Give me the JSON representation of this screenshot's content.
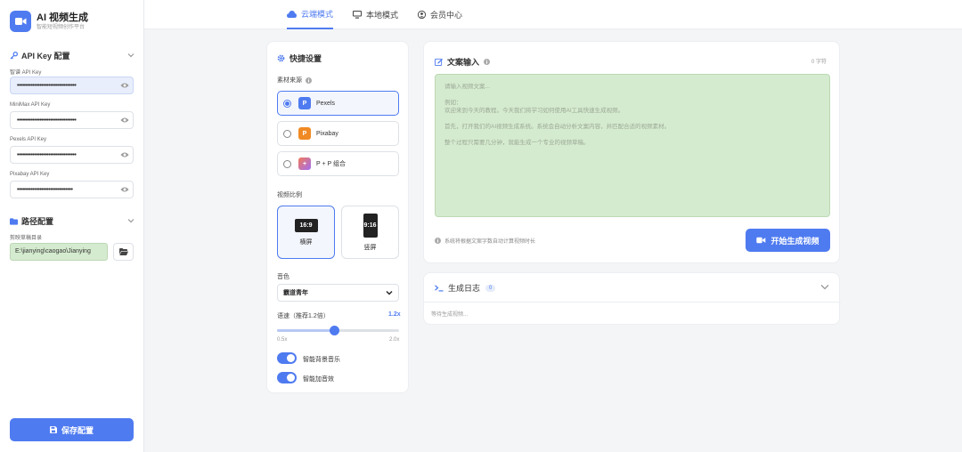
{
  "app": {
    "title": "AI 视频生成",
    "subtitle": "智能短视频创作平台"
  },
  "sidebar": {
    "api_section": {
      "title": "API Key 配置"
    },
    "api_keys": [
      {
        "label": "智谱 API Key",
        "value": "••••••••••••••••••••••••••••••••••"
      },
      {
        "label": "MiniMax API Key",
        "value": "••••••••••••••••••••••••••••••••••"
      },
      {
        "label": "Pexels API Key",
        "value": "••••••••••••••••••••••••••••••••••"
      },
      {
        "label": "Pixabay API Key",
        "value": "••••••••••••••••••••••••••••••••"
      }
    ],
    "path_section": {
      "title": "路径配置",
      "field_label": "剪映草稿目录",
      "value": "E:\\jianying\\caogao\\Jianying"
    },
    "save_label": "保存配置"
  },
  "tabs": [
    {
      "label": "云端模式",
      "icon": "cloud-icon",
      "active": true
    },
    {
      "label": "本地模式",
      "icon": "monitor-icon",
      "active": false
    },
    {
      "label": "会员中心",
      "icon": "user-icon",
      "active": false
    }
  ],
  "quick": {
    "title": "快捷设置",
    "source_label": "素材来源",
    "sources": [
      {
        "name": "Pexels",
        "badge": "P",
        "color": "#4f7bf0",
        "selected": true
      },
      {
        "name": "Pixabay",
        "badge": "P",
        "color": "#f08a24",
        "selected": false
      },
      {
        "name": "P + P 组合",
        "badge": "+",
        "color": "#b36be8",
        "selected": false
      }
    ],
    "ratio_label": "视频比例",
    "ratios": [
      {
        "value": "16:9",
        "label": "横屏",
        "selected": true
      },
      {
        "value": "9:16",
        "label": "竖屏",
        "selected": false
      }
    ],
    "voice_label": "音色",
    "voice_value": "霸道青年",
    "speed_label": "语速（推荐1.2倍）",
    "speed_value": "1.2x",
    "speed_min": "0.5x",
    "speed_max": "2.0x",
    "speed_fraction": 0.467,
    "toggles": [
      {
        "label": "智能背景音乐",
        "on": true
      },
      {
        "label": "智能加音效",
        "on": true
      }
    ]
  },
  "text_input": {
    "title": "文案输入",
    "char_count": "0 字符",
    "placeholder_lines": [
      "请输入视频文案...",
      "例如：\n欢迎来到今天的教程。今天我们将学习如何使用AI工具快速生成视频。",
      "首先，打开我们的AI视频生成系统。系统会自动分析文案内容，并匹配合适的视频素材。",
      "整个过程只需要几分钟，就能生成一个专业的视频草稿。"
    ],
    "hint": "系统将根据文案字数自动计算视频时长",
    "generate_label": "开始生成视频"
  },
  "log": {
    "title": "生成日志",
    "count": "0",
    "empty_text": "等待生成视频..."
  },
  "colors": {
    "accent": "#4f7bf0",
    "field_fill": "#d5ebcf"
  }
}
